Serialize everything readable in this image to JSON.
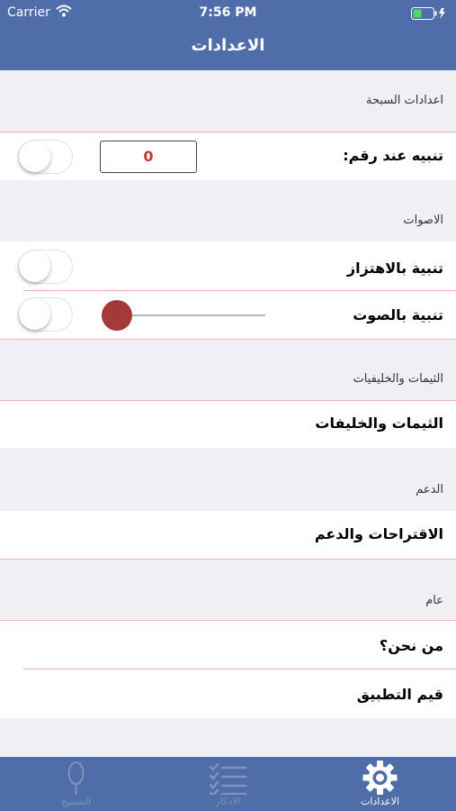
{
  "status_bar": {
    "carrier": "Carrier",
    "time": "7:56 PM"
  },
  "nav": {
    "title": "الاعدادات"
  },
  "sections": {
    "rosary": {
      "header": "اعدادات السبحة",
      "alert_at_number_label": "تنبيه عند رقم:",
      "alert_number_value": "0",
      "alert_switch_on": false
    },
    "sounds": {
      "header": "الاصوات",
      "vibration_label": "تنبية بالاهتزاز",
      "vibration_on": false,
      "sound_label": "تنبية بالصوت",
      "sound_on": false,
      "volume": 0
    },
    "themes": {
      "header": "الثيمات والخليفيات",
      "item_label": "الثيمات والخليفات"
    },
    "support": {
      "header": "الدعم",
      "item_label": "الاقتراحات والدعم"
    },
    "general": {
      "header": "عام",
      "about_label": "من نحن؟",
      "rate_label": "قيم التطبيق"
    }
  },
  "tabs": [
    {
      "label": "التسبيح",
      "icon": "rosary-icon",
      "active": false
    },
    {
      "label": "الاذكار",
      "icon": "checklist-icon",
      "active": false
    },
    {
      "label": "الاعدادات",
      "icon": "gear-icon",
      "active": true
    }
  ],
  "colors": {
    "nav_bar": "#4f6da8",
    "accent": "#a33939",
    "number_text": "#c0392b",
    "separator": "#e8b4b4"
  }
}
